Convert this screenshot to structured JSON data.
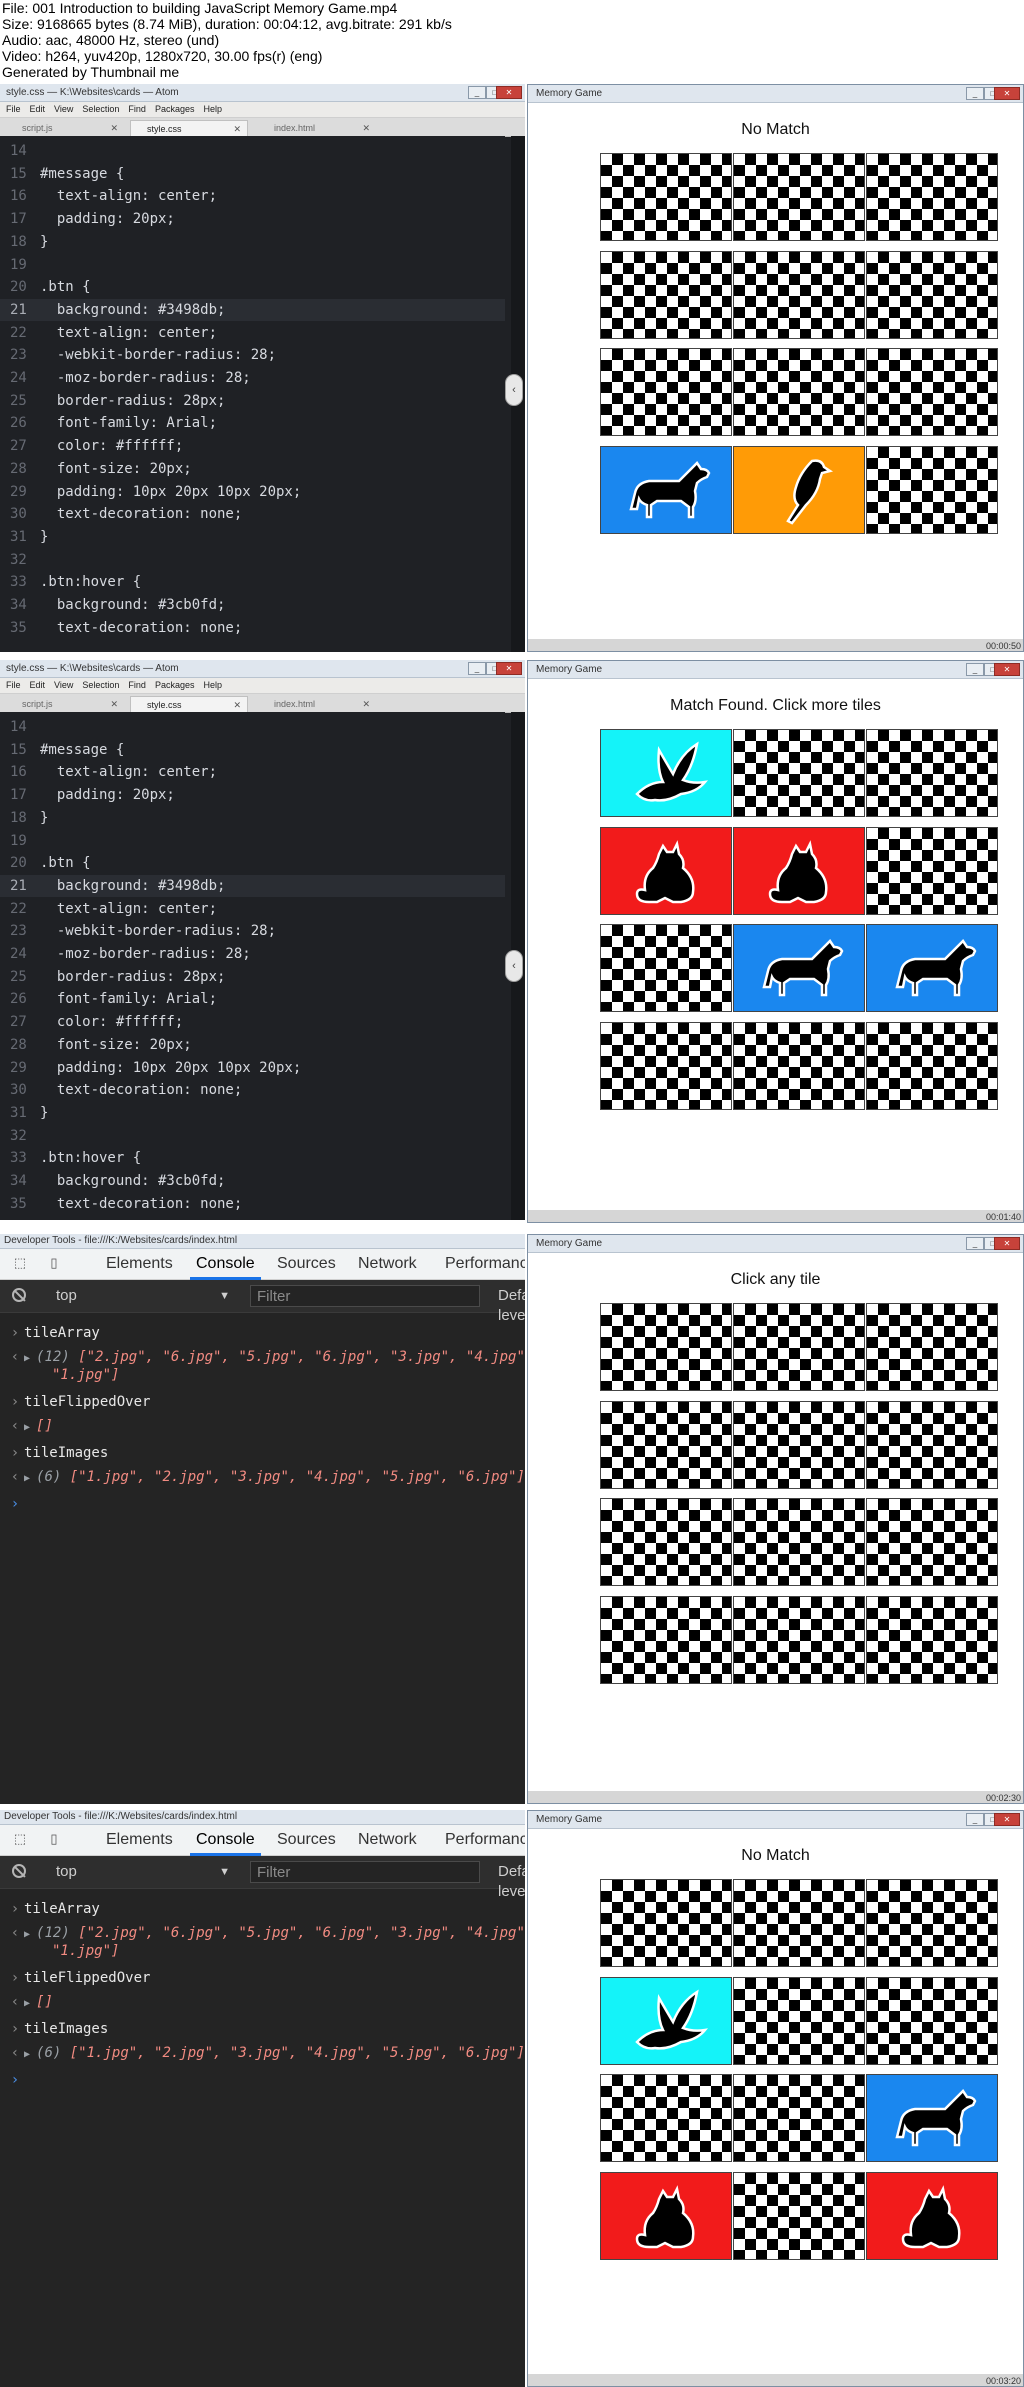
{
  "info": {
    "line1": "File: 001 Introduction to building JavaScript Memory Game.mp4",
    "line2": "Size: 9168665 bytes (8.74 MiB), duration: 00:04:12, avg.bitrate: 291 kb/s",
    "line3": "Audio: aac, 48000 Hz, stereo (und)",
    "line4": "Video: h264, yuv420p, 1280x720, 30.00 fps(r) (eng)",
    "line5": "Generated by Thumbnail me"
  },
  "atom": {
    "title": "style.css — K:\\Websites\\cards — Atom",
    "menus": [
      "File",
      "Edit",
      "View",
      "Selection",
      "Find",
      "Packages",
      "Help"
    ],
    "tabs": [
      "script.js",
      "style.css",
      "index.html"
    ],
    "lines": [
      {
        "n": "14",
        "code": ""
      },
      {
        "n": "15",
        "code": "#message {"
      },
      {
        "n": "16",
        "code": "  text-align: center;"
      },
      {
        "n": "17",
        "code": "  padding: 20px;"
      },
      {
        "n": "18",
        "code": "}"
      },
      {
        "n": "19",
        "code": ""
      },
      {
        "n": "20",
        "code": ".btn {"
      },
      {
        "n": "21",
        "code": "  background: #3498db;"
      },
      {
        "n": "22",
        "code": "  text-align: center;"
      },
      {
        "n": "23",
        "code": "  -webkit-border-radius: 28;"
      },
      {
        "n": "24",
        "code": "  -moz-border-radius: 28;"
      },
      {
        "n": "25",
        "code": "  border-radius: 28px;"
      },
      {
        "n": "26",
        "code": "  font-family: Arial;"
      },
      {
        "n": "27",
        "code": "  color: #ffffff;"
      },
      {
        "n": "28",
        "code": "  font-size: 20px;"
      },
      {
        "n": "29",
        "code": "  padding: 10px 20px 10px 20px;"
      },
      {
        "n": "30",
        "code": "  text-decoration: none;"
      },
      {
        "n": "31",
        "code": "}"
      },
      {
        "n": "32",
        "code": ""
      },
      {
        "n": "33",
        "code": ".btn:hover {"
      },
      {
        "n": "34",
        "code": "  background: #3cb0fd;"
      },
      {
        "n": "35",
        "code": "  text-decoration: none;"
      }
    ]
  },
  "game": {
    "window_title": "Memory Game",
    "panels": [
      {
        "message": "No Match",
        "timestamp": "00:00:50",
        "tiles": [
          "back",
          "back",
          "back",
          "back",
          "back",
          "back",
          "back",
          "back",
          "back",
          "blue:dog",
          "orange:parrot",
          "back"
        ]
      },
      {
        "message": "Match Found. Click more tiles",
        "timestamp": "00:01:40",
        "tiles": [
          "cyan:bird",
          "back",
          "back",
          "red:cat",
          "red:cat",
          "back",
          "back",
          "blue:dog",
          "blue:dog",
          "back",
          "back",
          "back"
        ]
      },
      {
        "message": "Click any tile",
        "timestamp": "00:02:30",
        "tiles": [
          "back",
          "back",
          "back",
          "back",
          "back",
          "back",
          "back",
          "back",
          "back",
          "back",
          "back",
          "back"
        ]
      },
      {
        "message": "No Match",
        "timestamp": "00:03:20",
        "tiles": [
          "back",
          "back",
          "back",
          "cyan:bird",
          "back",
          "back",
          "back",
          "back",
          "blue:dog",
          "red:cat",
          "back",
          "red:cat"
        ]
      }
    ]
  },
  "devtools": {
    "title": "Developer Tools - file:///K:/Websites/cards/index.html",
    "tabs": [
      "Elements",
      "Console",
      "Sources",
      "Network",
      "Performance"
    ],
    "context": "top",
    "filter_placeholder": "Filter",
    "levels": "Default levels",
    "console": [
      {
        "kind": "in",
        "text": "tileArray"
      },
      {
        "kind": "out",
        "prefix": "(12) ",
        "text": "[\"2.jpg\", \"6.jpg\", \"5.jpg\", \"6.jpg\", \"3.jpg\", \"4.jpg\","
      },
      {
        "kind": "cont",
        "text": "\"1.jpg\"]"
      },
      {
        "kind": "in",
        "text": "tileFlippedOver"
      },
      {
        "kind": "out",
        "prefix": "",
        "text": "[]"
      },
      {
        "kind": "in",
        "text": "tileImages"
      },
      {
        "kind": "out",
        "prefix": "(6) ",
        "text": "[\"1.jpg\", \"2.jpg\", \"3.jpg\", \"4.jpg\", \"5.jpg\", \"6.jpg\"]"
      }
    ]
  }
}
